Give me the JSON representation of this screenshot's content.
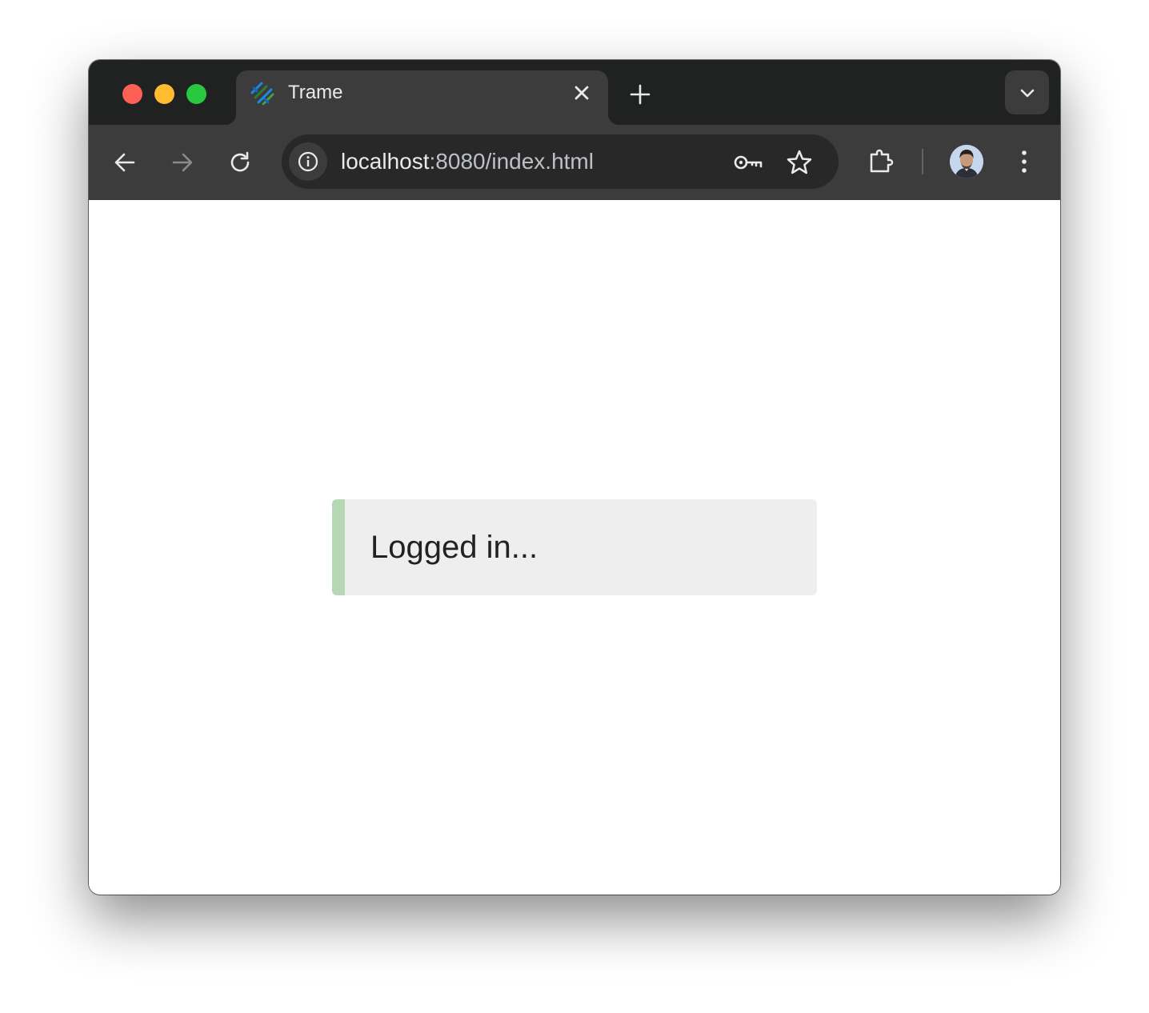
{
  "browser": {
    "tab": {
      "title": "Trame",
      "favicon": "trame-logo-icon"
    },
    "toolbar": {
      "back_icon": "back-arrow-icon",
      "forward_icon": "forward-arrow-icon",
      "reload_icon": "reload-icon",
      "url_host": "localhost",
      "url_rest": ":8080/index.html",
      "password_icon": "key-icon",
      "bookmark_icon": "star-icon",
      "extensions_icon": "puzzle-icon",
      "menu_icon": "three-dots-icon"
    }
  },
  "page": {
    "status_message": "Logged in..."
  },
  "colors": {
    "alert_background": "#eeeeee",
    "alert_accent": "#b5d7b3",
    "tabstrip": "#202121",
    "toolbar": "#3c3c3c"
  }
}
